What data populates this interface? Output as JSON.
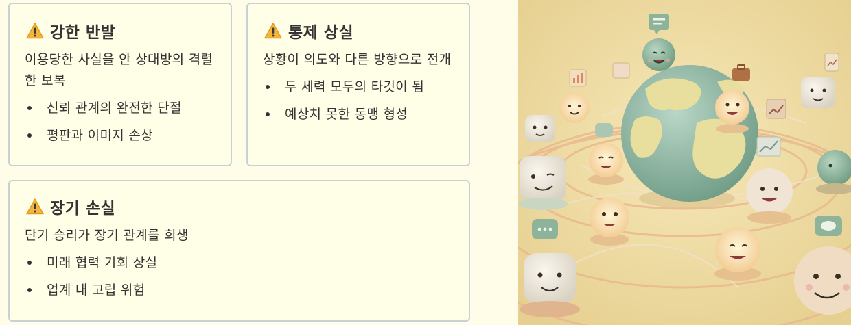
{
  "cards": [
    {
      "title": "강한 반발",
      "icon": "warning-icon",
      "description": "이용당한 사실을 안 상대방의 격렬한 보복",
      "items": [
        "신뢰 관계의 완전한 단절",
        "평판과 이미지 손상"
      ]
    },
    {
      "title": "통제 상실",
      "icon": "warning-icon",
      "description": "상황이 의도와 다른 방향으로 전개",
      "items": [
        "두 세력 모두의 타깃이 됨",
        "예상치 못한 동맹 형성"
      ]
    },
    {
      "title": "장기 손실",
      "icon": "warning-icon",
      "description": "단기 승리가 장기 관계를 희생",
      "items": [
        "미래 협력 기회 상실",
        "업계 내 고립 위험"
      ]
    }
  ],
  "colors": {
    "card_background": "#fffee6",
    "card_border": "#c6d2d6",
    "warning_yellow": "#f4b53f",
    "illustration_background": "#f1dfa7"
  }
}
